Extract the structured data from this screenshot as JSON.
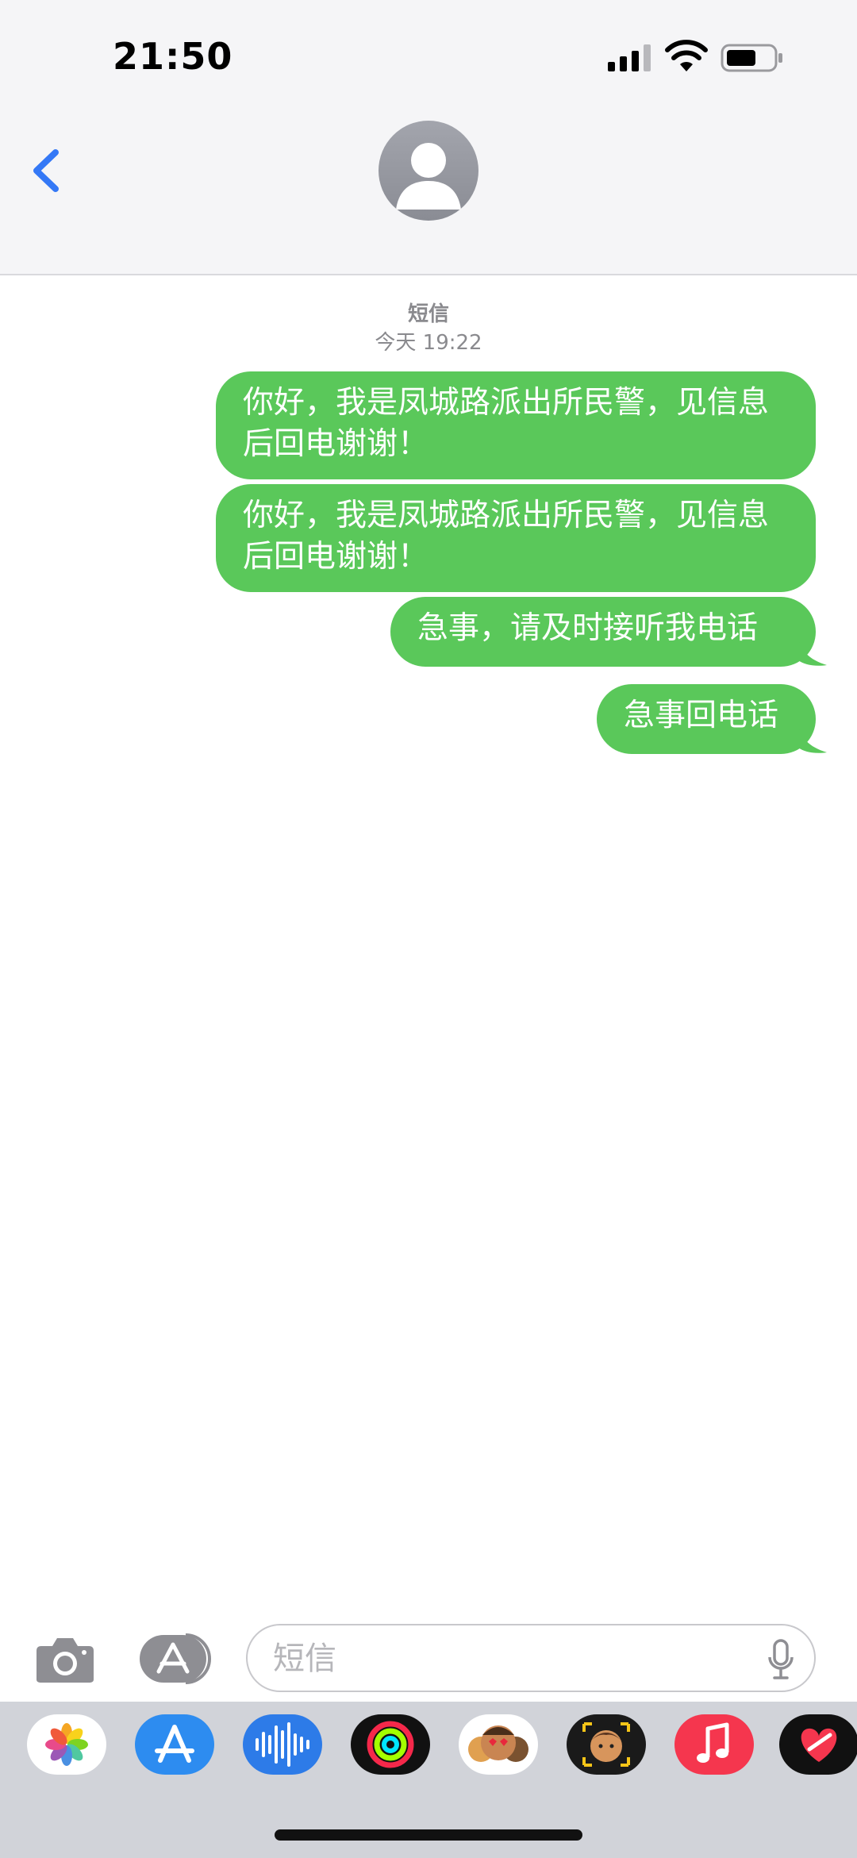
{
  "status_bar": {
    "time": "21:50"
  },
  "header": {
    "avatar_icon": "contact-avatar-icon",
    "back_icon": "chevron-left-icon"
  },
  "thread": {
    "service": "短信",
    "timestamp": "今天 19:22"
  },
  "messages": [
    {
      "text": "你好，我是凤城路派出所民警，见信息后回电谢谢！",
      "direction": "outgoing"
    },
    {
      "text": "你好，我是凤城路派出所民警，见信息后回电谢谢！",
      "direction": "outgoing"
    },
    {
      "text": "急事，请及时接听我电话",
      "direction": "outgoing"
    },
    {
      "text": "急事回电话",
      "direction": "outgoing"
    }
  ],
  "compose": {
    "placeholder": "短信",
    "value": ""
  },
  "app_drawer": [
    "photos-app-icon",
    "app-store-app-icon",
    "audio-message-app-icon",
    "activity-app-icon",
    "memoji-stickers-app-icon",
    "memoji-app-icon",
    "music-app-icon",
    "digital-touch-app-icon"
  ],
  "colors": {
    "bubble": "#5ac85a",
    "accent": "#3478f6",
    "header_bg": "#f5f5f7"
  }
}
